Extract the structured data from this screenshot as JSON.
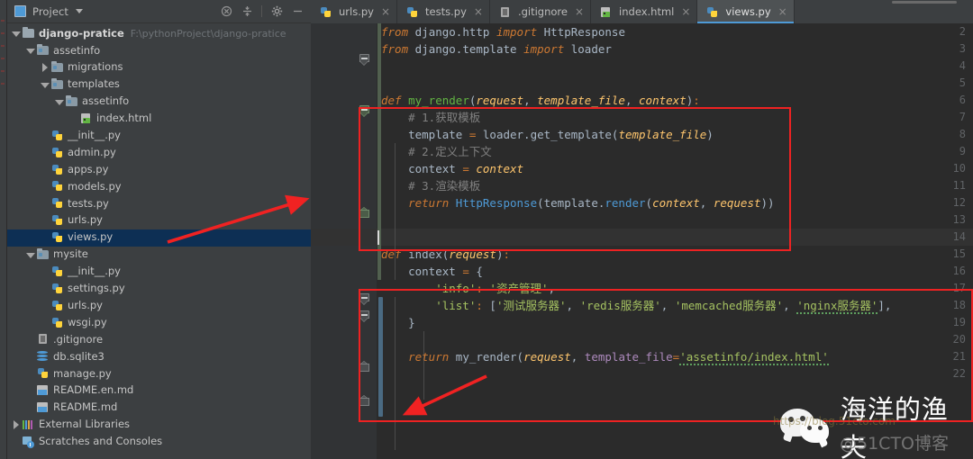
{
  "window": {
    "project_panel_title": "Project",
    "toolbar_icons": [
      "collapse-all-icon",
      "expand-all-icon",
      "settings-gear-icon",
      "hide-icon"
    ]
  },
  "tree": [
    {
      "label": "django-pratice",
      "path": "F:\\pythonProject\\django-pratice",
      "icon": "folder-icon",
      "arrow": "down",
      "indent": 0,
      "bold": true,
      "selected": false
    },
    {
      "label": "assetinfo",
      "path": "",
      "icon": "folder-module-icon",
      "arrow": "down",
      "indent": 1,
      "bold": false,
      "selected": false
    },
    {
      "label": "migrations",
      "path": "",
      "icon": "folder-module-icon",
      "arrow": "right",
      "indent": 2,
      "bold": false,
      "selected": false
    },
    {
      "label": "templates",
      "path": "",
      "icon": "folder-module-icon",
      "arrow": "down",
      "indent": 2,
      "bold": false,
      "selected": false
    },
    {
      "label": "assetinfo",
      "path": "",
      "icon": "folder-module-icon",
      "arrow": "down",
      "indent": 3,
      "bold": false,
      "selected": false
    },
    {
      "label": "index.html",
      "path": "",
      "icon": "html-file-icon",
      "arrow": "none",
      "indent": 4,
      "bold": false,
      "selected": false
    },
    {
      "label": "__init__.py",
      "path": "",
      "icon": "python-file-icon",
      "arrow": "none",
      "indent": 2,
      "bold": false,
      "selected": false
    },
    {
      "label": "admin.py",
      "path": "",
      "icon": "python-file-icon",
      "arrow": "none",
      "indent": 2,
      "bold": false,
      "selected": false
    },
    {
      "label": "apps.py",
      "path": "",
      "icon": "python-file-icon",
      "arrow": "none",
      "indent": 2,
      "bold": false,
      "selected": false
    },
    {
      "label": "models.py",
      "path": "",
      "icon": "python-file-icon",
      "arrow": "none",
      "indent": 2,
      "bold": false,
      "selected": false
    },
    {
      "label": "tests.py",
      "path": "",
      "icon": "python-file-icon",
      "arrow": "none",
      "indent": 2,
      "bold": false,
      "selected": false
    },
    {
      "label": "urls.py",
      "path": "",
      "icon": "python-file-icon",
      "arrow": "none",
      "indent": 2,
      "bold": false,
      "selected": false
    },
    {
      "label": "views.py",
      "path": "",
      "icon": "python-file-icon",
      "arrow": "none",
      "indent": 2,
      "bold": false,
      "selected": true
    },
    {
      "label": "mysite",
      "path": "",
      "icon": "folder-module-icon",
      "arrow": "down",
      "indent": 1,
      "bold": false,
      "selected": false
    },
    {
      "label": "__init__.py",
      "path": "",
      "icon": "python-file-icon",
      "arrow": "none",
      "indent": 2,
      "bold": false,
      "selected": false
    },
    {
      "label": "settings.py",
      "path": "",
      "icon": "python-file-icon",
      "arrow": "none",
      "indent": 2,
      "bold": false,
      "selected": false
    },
    {
      "label": "urls.py",
      "path": "",
      "icon": "python-file-icon",
      "arrow": "none",
      "indent": 2,
      "bold": false,
      "selected": false
    },
    {
      "label": "wsgi.py",
      "path": "",
      "icon": "python-file-icon",
      "arrow": "none",
      "indent": 2,
      "bold": false,
      "selected": false
    },
    {
      "label": ".gitignore",
      "path": "",
      "icon": "gitignore-file-icon",
      "arrow": "none",
      "indent": 1,
      "bold": false,
      "selected": false
    },
    {
      "label": "db.sqlite3",
      "path": "",
      "icon": "database-file-icon",
      "arrow": "none",
      "indent": 1,
      "bold": false,
      "selected": false
    },
    {
      "label": "manage.py",
      "path": "",
      "icon": "python-file-icon",
      "arrow": "none",
      "indent": 1,
      "bold": false,
      "selected": false
    },
    {
      "label": "README.en.md",
      "path": "",
      "icon": "markdown-file-icon",
      "arrow": "none",
      "indent": 1,
      "bold": false,
      "selected": false
    },
    {
      "label": "README.md",
      "path": "",
      "icon": "markdown-file-icon",
      "arrow": "none",
      "indent": 1,
      "bold": false,
      "selected": false
    },
    {
      "label": "External Libraries",
      "path": "",
      "icon": "libraries-icon",
      "arrow": "right",
      "indent": 0,
      "bold": false,
      "selected": false
    },
    {
      "label": "Scratches and Consoles",
      "path": "",
      "icon": "scratches-icon",
      "arrow": "none",
      "indent": 0,
      "bold": false,
      "selected": false
    }
  ],
  "tabs": [
    {
      "label": "urls.py",
      "icon": "python-file-icon",
      "active": false,
      "close": "×"
    },
    {
      "label": "tests.py",
      "icon": "python-file-icon",
      "active": false,
      "close": "×"
    },
    {
      "label": ".gitignore",
      "icon": "gitignore-file-icon",
      "active": false,
      "close": "×"
    },
    {
      "label": "index.html",
      "icon": "html-file-icon",
      "active": false,
      "close": "×"
    },
    {
      "label": "views.py",
      "icon": "python-file-icon",
      "active": true,
      "close": "×"
    }
  ],
  "editor": {
    "file": "views.py",
    "first_visible_line": 2,
    "last_visible_line": 22,
    "caret_line": 14,
    "line_numbers": [
      "2",
      "3",
      "4",
      "5",
      "6",
      "7",
      "8",
      "9",
      "10",
      "11",
      "12",
      "13",
      "14",
      "15",
      "16",
      "17",
      "18",
      "19",
      "20",
      "21",
      "22"
    ],
    "lines": [
      {
        "n": "2",
        "text": "from django.http import HttpResponse"
      },
      {
        "n": "3",
        "text": "from django.template import loader"
      },
      {
        "n": "4",
        "text": ""
      },
      {
        "n": "5",
        "text": ""
      },
      {
        "n": "6",
        "text": "def my_render(request, template_file, context):"
      },
      {
        "n": "7",
        "text": "    # 1.获取模板"
      },
      {
        "n": "8",
        "text": "    template = loader.get_template(template_file)"
      },
      {
        "n": "9",
        "text": "    # 2.定义上下文"
      },
      {
        "n": "10",
        "text": "    context = context"
      },
      {
        "n": "11",
        "text": "    # 3.渲染模板"
      },
      {
        "n": "12",
        "text": "    return HttpResponse(template.render(context, request))"
      },
      {
        "n": "13",
        "text": ""
      },
      {
        "n": "14",
        "text": ""
      },
      {
        "n": "15",
        "text": "def index(request):"
      },
      {
        "n": "16",
        "text": "    context = {"
      },
      {
        "n": "17",
        "text": "        'info': '资产管理',"
      },
      {
        "n": "18",
        "text": "        'list': ['测试服务器', 'redis服务器', 'memcached服务器', 'nginx服务器'],"
      },
      {
        "n": "19",
        "text": "    }"
      },
      {
        "n": "20",
        "text": ""
      },
      {
        "n": "21",
        "text": "    return my_render(request, template_file='assetinfo/index.html'"
      },
      {
        "n": "22",
        "text": ""
      }
    ],
    "tokens": {
      "from": "from",
      "import": "import",
      "def": "def",
      "return": "return",
      "httpresponse": "HttpResponse",
      "loader": "loader",
      "django_http": "django.http",
      "django_template": "django.template",
      "my_render": "my_render",
      "index_fn": "index",
      "request": "request",
      "template_file": "template_file",
      "context": "context",
      "template_var": "template",
      "get_template": "get_template",
      "render": "render",
      "comment1": "# 1.获取模板",
      "comment2": "# 2.定义上下文",
      "comment3": "# 3.渲染模板",
      "key_info": "'info'",
      "val_info": "'资产管理'",
      "key_list": "'list'",
      "s1": "'测试服务器'",
      "s2": "'redis服务器'",
      "s3": "'memcached服务器'",
      "s4": "'nginx服务器'",
      "tf_kwarg": "template_file",
      "tf_value": "'assetinfo/index.html'"
    }
  },
  "annotations": {
    "box1_desc": "red-highlight-my-render-function",
    "box2_desc": "red-highlight-index-function",
    "arrow1_desc": "arrow-from-views-py-to-code",
    "arrow2_desc": "arrow-pointing-to-return-line"
  },
  "watermark": {
    "brand": "海洋的渔夫",
    "sub": "@51CTO博客",
    "faint": "https://blog.51cto.com",
    "logo": "wechat-logo-icon"
  }
}
